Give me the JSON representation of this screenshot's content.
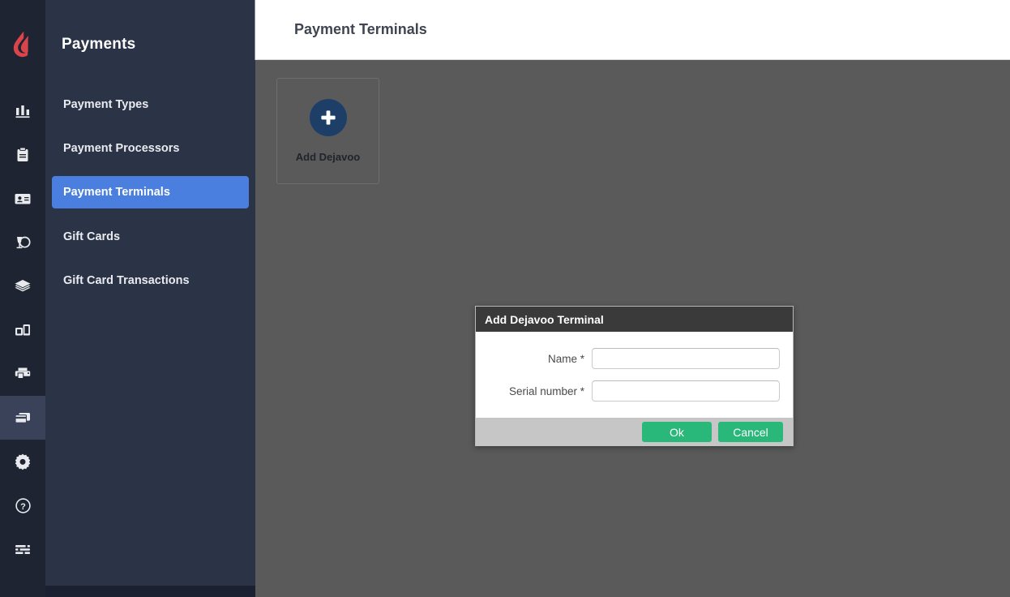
{
  "app": {
    "logo_icon": "lightspeed-flame-logo",
    "brand_color": "#d9454a"
  },
  "sidebar": {
    "title": "Payments",
    "active_color": "#4a7fe0",
    "rail_icons": [
      {
        "name": "bar-chart-icon",
        "active": false
      },
      {
        "name": "clipboard-icon",
        "active": false
      },
      {
        "name": "id-card-icon",
        "active": false
      },
      {
        "name": "wine-glass-icon",
        "active": false
      },
      {
        "name": "layers-icon",
        "active": false
      },
      {
        "name": "devices-icon",
        "active": false
      },
      {
        "name": "printer-icon",
        "active": false
      },
      {
        "name": "payment-cards-icon",
        "active": true
      },
      {
        "name": "gear-icon",
        "active": false
      },
      {
        "name": "help-circle-icon",
        "active": false
      },
      {
        "name": "list-settings-icon",
        "active": false
      }
    ],
    "items": [
      {
        "label": "Payment Types",
        "active": false
      },
      {
        "label": "Payment Processors",
        "active": false
      },
      {
        "label": "Payment Terminals",
        "active": true
      },
      {
        "label": "Gift Cards",
        "active": false
      },
      {
        "label": "Gift Card Transactions",
        "active": false
      }
    ]
  },
  "header": {
    "title": "Payment Terminals"
  },
  "content": {
    "add_card": {
      "label": "Add Dejavoo",
      "icon": "plus-icon",
      "circle_color": "#1d3f67"
    }
  },
  "dialog": {
    "title": "Add Dejavoo Terminal",
    "fields": [
      {
        "label": "Name *",
        "value": "",
        "placeholder": ""
      },
      {
        "label": "Serial number *",
        "value": "",
        "placeholder": ""
      }
    ],
    "buttons": {
      "ok": "Ok",
      "cancel": "Cancel",
      "color": "#2ab87a"
    }
  }
}
